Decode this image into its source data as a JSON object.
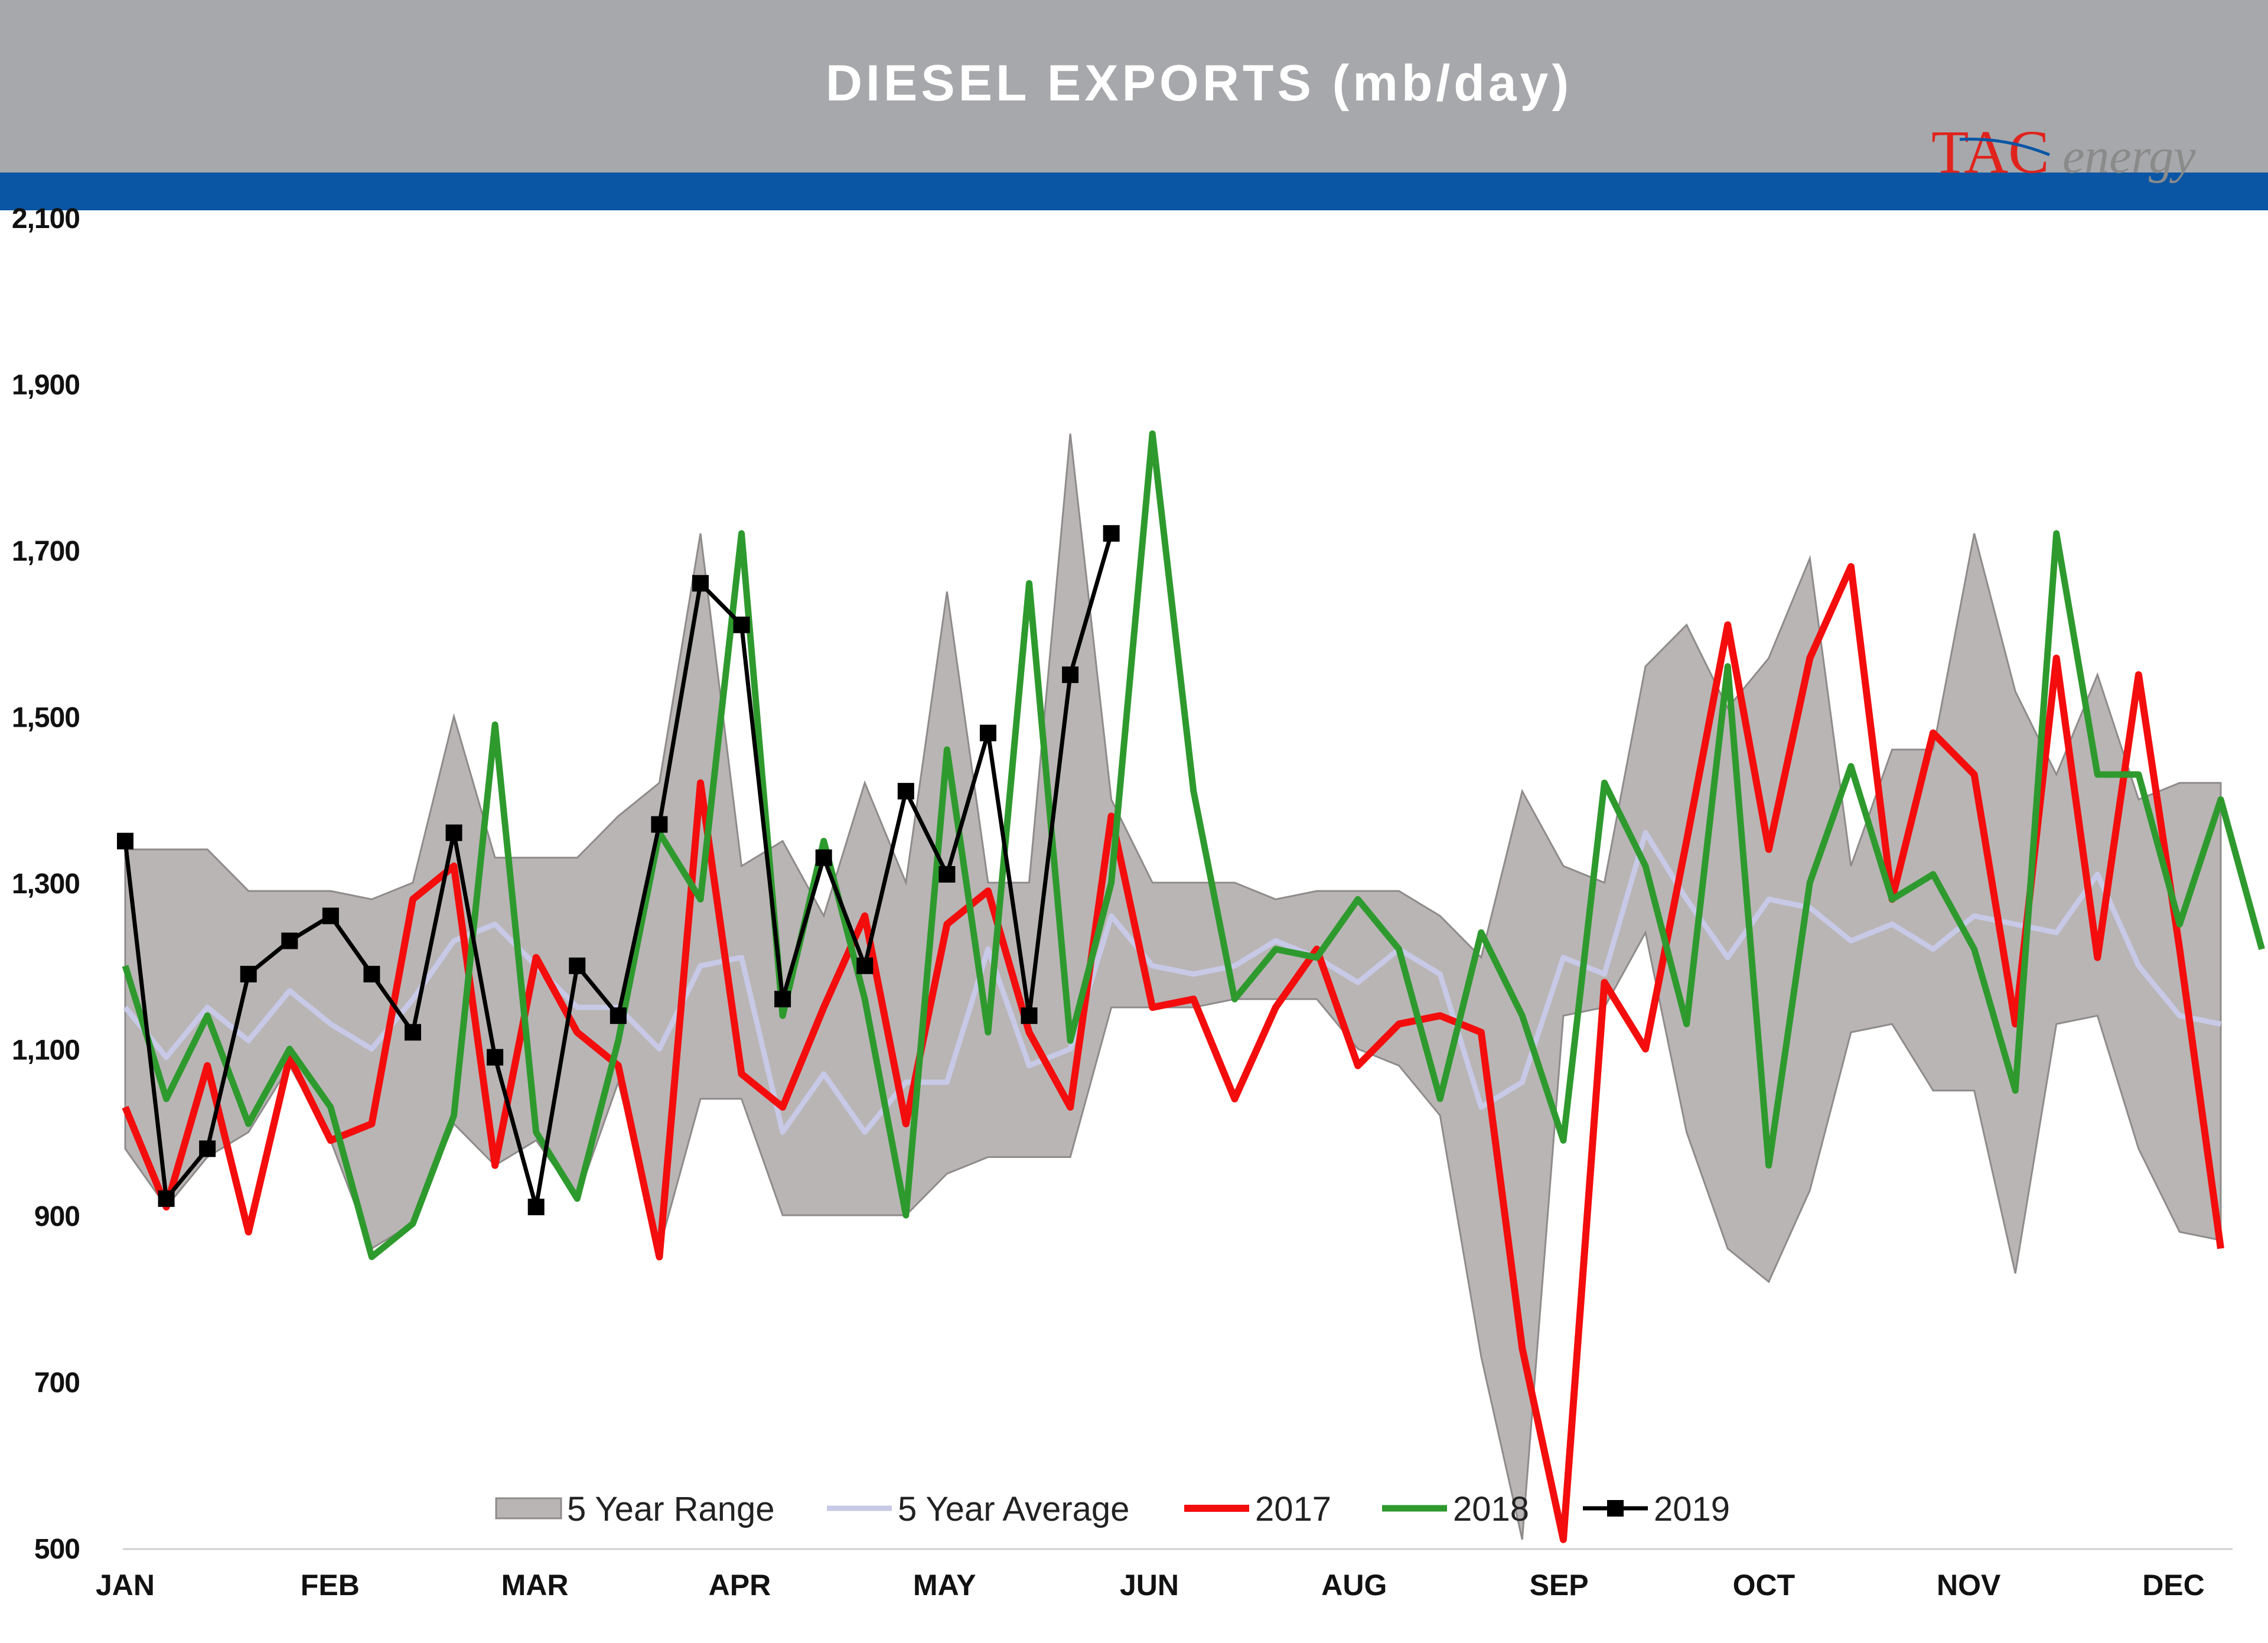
{
  "header": {
    "title": "DIESEL EXPORTS (mb/day)",
    "logo_text_left": "TAC",
    "logo_text_right": "energy"
  },
  "colors": {
    "header_band": "#a7a8ab",
    "blue_band": "#0a56a4",
    "range_fill": "#b9b5b5",
    "range_edge": "#8f8b8b",
    "avg": "#c7c9e6",
    "y2017": "#f40d0d",
    "y2018": "#2e9a2e",
    "y2019": "#000000",
    "title_text": "#ffffff",
    "logo_red": "#e0231c",
    "logo_gray": "#8a8a8a"
  },
  "chart_data": {
    "type": "line",
    "title": "DIESEL EXPORTS (mb/day)",
    "ylim": [
      500,
      2100
    ],
    "yticks": [
      500,
      700,
      900,
      1100,
      1300,
      1500,
      1700,
      1900,
      2100
    ],
    "ytick_labels": [
      "500",
      "700",
      "900",
      "1,100",
      "1,300",
      "1,500",
      "1,700",
      "1,900",
      "2,100"
    ],
    "month_labels": [
      "JAN",
      "FEB",
      "MAR",
      "APR",
      "MAY",
      "JUN",
      "AUG",
      "SEP",
      "OCT",
      "NOV",
      "DEC"
    ],
    "x_count": 52,
    "legend": {
      "position": "bottom-center",
      "items": [
        "5 Year Range",
        "5 Year Average",
        "2017",
        "2018",
        "2019"
      ]
    },
    "series": [
      {
        "name": "5 Year Range",
        "kind": "band",
        "high": [
          1340,
          1340,
          1340,
          1290,
          1290,
          1290,
          1280,
          1300,
          1500,
          1330,
          1330,
          1330,
          1380,
          1420,
          1720,
          1320,
          1350,
          1260,
          1420,
          1300,
          1650,
          1300,
          1300,
          1840,
          1400,
          1300,
          1300,
          1300,
          1280,
          1290,
          1290,
          1290,
          1260,
          1210,
          1410,
          1320,
          1300,
          1560,
          1610,
          1510,
          1570,
          1690,
          1320,
          1460,
          1460,
          1720,
          1530,
          1430,
          1550,
          1400,
          1420,
          1420
        ],
        "low": [
          980,
          910,
          970,
          1000,
          1080,
          990,
          860,
          890,
          1010,
          960,
          990,
          920,
          1060,
          860,
          1040,
          1040,
          900,
          900,
          900,
          900,
          950,
          970,
          970,
          970,
          1150,
          1150,
          1150,
          1160,
          1160,
          1160,
          1100,
          1080,
          1020,
          730,
          510,
          1140,
          1150,
          1240,
          1000,
          860,
          820,
          930,
          1120,
          1130,
          1050,
          1050,
          830,
          1130,
          1140,
          980,
          880,
          870
        ]
      },
      {
        "name": "5 Year Average",
        "kind": "line",
        "values": [
          1150,
          1090,
          1150,
          1110,
          1170,
          1130,
          1100,
          1160,
          1230,
          1250,
          1200,
          1150,
          1150,
          1100,
          1200,
          1210,
          1000,
          1070,
          1000,
          1060,
          1060,
          1220,
          1080,
          1100,
          1260,
          1200,
          1190,
          1200,
          1230,
          1210,
          1180,
          1220,
          1190,
          1030,
          1060,
          1210,
          1190,
          1360,
          1280,
          1210,
          1280,
          1270,
          1230,
          1250,
          1220,
          1260,
          1250,
          1240,
          1310,
          1200,
          1140,
          1130
        ]
      },
      {
        "name": "2017",
        "kind": "line",
        "values": [
          1030,
          910,
          1080,
          880,
          1090,
          990,
          1010,
          1280,
          1320,
          960,
          1210,
          1120,
          1080,
          850,
          1420,
          1070,
          1030,
          1150,
          1260,
          1010,
          1250,
          1290,
          1120,
          1030,
          1380,
          1150,
          1160,
          1040,
          1150,
          1220,
          1080,
          1130,
          1140,
          1120,
          740,
          510,
          1180,
          1100,
          1350,
          1610,
          1340,
          1570,
          1680,
          1280,
          1480,
          1430,
          1130,
          1570,
          1210,
          1550,
          1220,
          860
        ]
      },
      {
        "name": "2018",
        "kind": "line",
        "values": [
          1200,
          1040,
          1140,
          1010,
          1100,
          1030,
          850,
          890,
          1020,
          1490,
          1000,
          920,
          1110,
          1360,
          1280,
          1720,
          1140,
          1350,
          1160,
          900,
          1460,
          1120,
          1660,
          1110,
          1300,
          1840,
          1410,
          1160,
          1220,
          1210,
          1280,
          1220,
          1040,
          1240,
          1140,
          990,
          1420,
          1320,
          1130,
          1560,
          960,
          1300,
          1440,
          1280,
          1310,
          1220,
          1050,
          1720,
          1430,
          1430,
          1250,
          1400,
          1220
        ]
      },
      {
        "name": "2019",
        "kind": "line-markers",
        "values": [
          1350,
          920,
          980,
          1190,
          1230,
          1260,
          1190,
          1120,
          1360,
          1090,
          910,
          1200,
          1140,
          1370,
          1660,
          1610,
          1160,
          1330,
          1200,
          1410,
          1310,
          1480,
          1140,
          1550,
          1720
        ]
      }
    ]
  }
}
